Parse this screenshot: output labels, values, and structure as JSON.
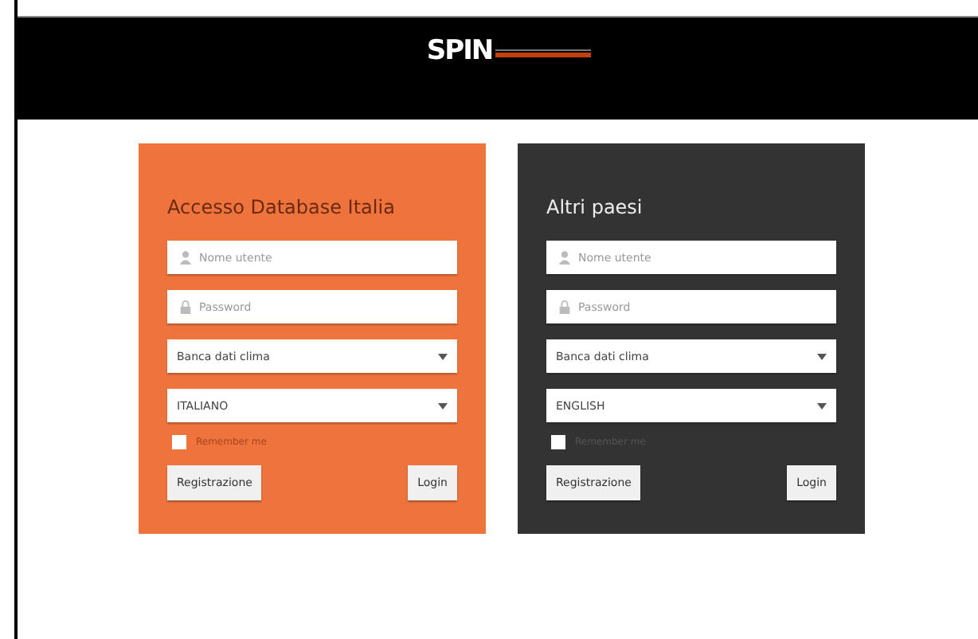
{
  "header": {
    "logo": "SPIN"
  },
  "panels": [
    {
      "kind": "orange",
      "title": "Accesso Database Italia",
      "username": {
        "placeholder": "Nome utente"
      },
      "password": {
        "placeholder": "Password"
      },
      "database": {
        "value": "Banca dati clima"
      },
      "language": {
        "value": "ITALIANO"
      },
      "remember": {
        "label": "Remember me",
        "checked": false
      },
      "buttons": [
        "Registrazione",
        "Login"
      ]
    },
    {
      "kind": "dark",
      "title": "Altri paesi",
      "username": {
        "placeholder": "Nome utente"
      },
      "password": {
        "placeholder": "Password"
      },
      "database": {
        "value": "Banca dati clima"
      },
      "language": {
        "value": "ENGLISH"
      },
      "remember": {
        "label": "Remember me",
        "checked": false
      },
      "buttons": [
        "Registrazione",
        "Login"
      ]
    }
  ]
}
